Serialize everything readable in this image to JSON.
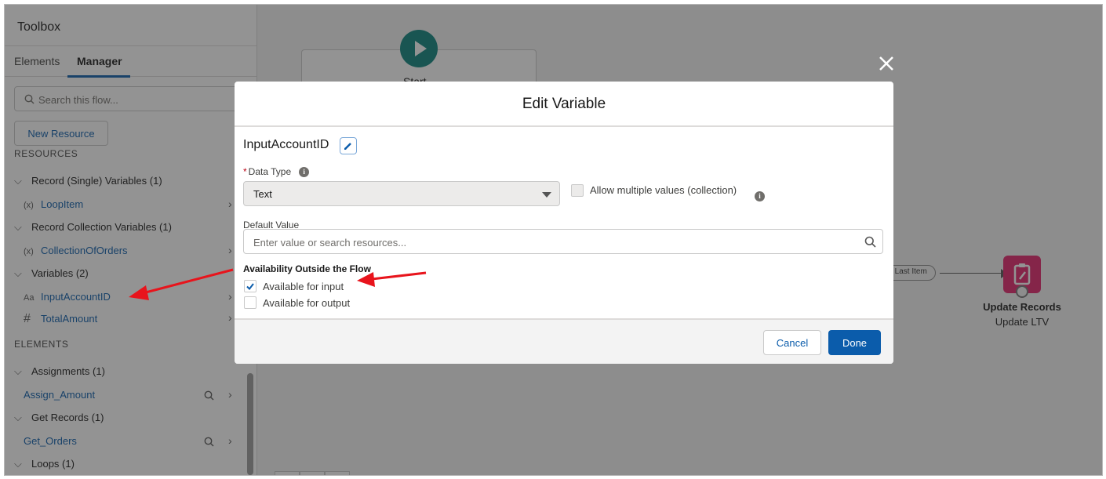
{
  "toolbox": {
    "title": "Toolbox",
    "tabs": [
      {
        "label": "Elements",
        "active": false
      },
      {
        "label": "Manager",
        "active": true
      }
    ],
    "search_placeholder": "Search this flow...",
    "new_resource_label": "New Resource",
    "resources_heading": "RESOURCES",
    "resource_groups": [
      {
        "label": "Record (Single) Variables (1)",
        "items": [
          {
            "label": "LoopItem",
            "icon": "record-variable-icon",
            "glyph": "(x)"
          }
        ]
      },
      {
        "label": "Record Collection Variables (1)",
        "items": [
          {
            "label": "CollectionOfOrders",
            "icon": "record-collection-icon",
            "glyph": "(x)"
          }
        ]
      },
      {
        "label": "Variables (2)",
        "items": [
          {
            "label": "InputAccountID",
            "icon": "text-variable-icon",
            "glyph": "Aa"
          },
          {
            "label": "TotalAmount",
            "icon": "number-variable-icon",
            "glyph": "#"
          }
        ]
      }
    ],
    "elements_heading": "ELEMENTS",
    "element_groups": [
      {
        "label": "Assignments (1)",
        "items": [
          {
            "label": "Assign_Amount"
          }
        ]
      },
      {
        "label": "Get Records (1)",
        "items": [
          {
            "label": "Get_Orders"
          }
        ]
      },
      {
        "label": "Loops (1)",
        "items": []
      }
    ]
  },
  "canvas": {
    "start_label": "Start",
    "connector_label": "er Last Item",
    "update_node_title": "Update Records",
    "update_node_subtitle": "Update LTV"
  },
  "modal": {
    "title": "Edit Variable",
    "variable_name": "InputAccountID",
    "data_type_label": "Data Type",
    "data_type_value": "Text",
    "allow_multiple_label": "Allow multiple values (collection)",
    "default_value_label": "Default Value",
    "default_value_placeholder": "Enter value or search resources...",
    "availability_title": "Availability Outside the Flow",
    "available_input_label": "Available for input",
    "available_input_checked": true,
    "available_output_label": "Available for output",
    "available_output_checked": false,
    "cancel_label": "Cancel",
    "done_label": "Done"
  },
  "colors": {
    "brand_blue": "#0b5cab",
    "start_teal": "#0b827c",
    "update_pink": "#e3236b",
    "annotation_red": "#e8141c"
  }
}
